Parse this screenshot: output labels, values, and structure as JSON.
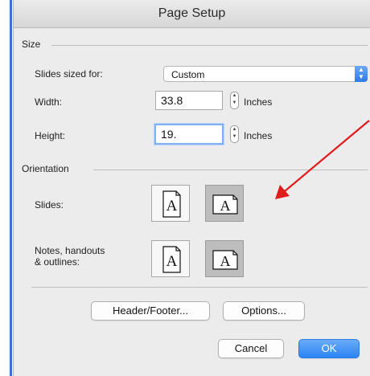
{
  "window": {
    "title": "Page Setup"
  },
  "size": {
    "section_label": "Size",
    "slides_sized_for_label": "Slides sized for:",
    "slides_sized_for_value": "Custom",
    "width_label": "Width:",
    "width_value": "33.8",
    "width_unit": "Inches",
    "height_label": "Height:",
    "height_value": "19.",
    "height_unit": "Inches"
  },
  "orientation": {
    "section_label": "Orientation",
    "slides_label": "Slides:",
    "notes_label_line1": "Notes, handouts",
    "notes_label_line2": "& outlines:",
    "glyph": "A",
    "slides_selected": "landscape",
    "notes_selected": "landscape"
  },
  "buttons": {
    "header_footer": "Header/Footer...",
    "options": "Options...",
    "cancel": "Cancel",
    "ok": "OK"
  },
  "colors": {
    "accent_blue": "#2b84f2",
    "annotation_red": "#e01b1b"
  }
}
